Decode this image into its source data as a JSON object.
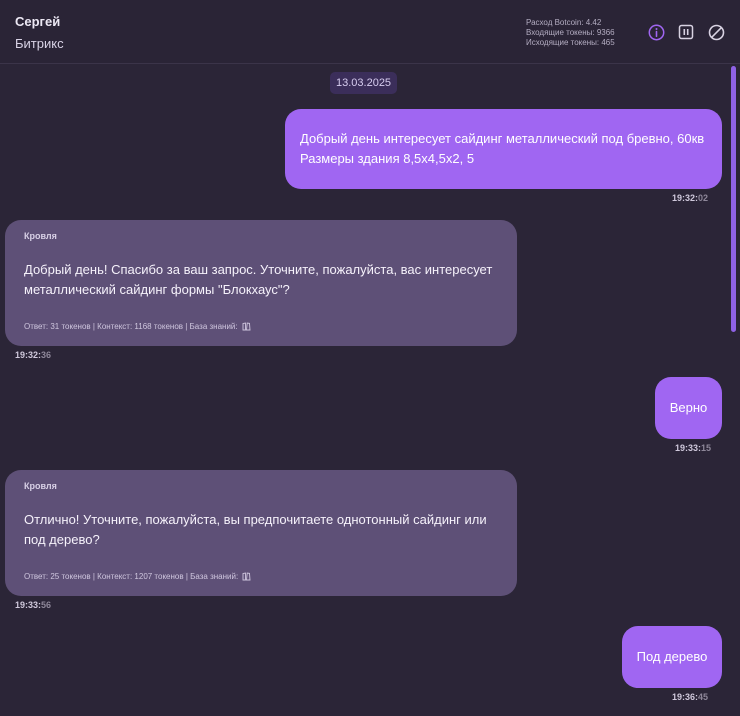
{
  "header": {
    "contact_name": "Сергей",
    "contact_source": "Битрикс",
    "stats": {
      "cost": "Расход Botcoin: 4.42",
      "input_tokens": "Входящие токены: 9366",
      "output_tokens": "Исходящие токены: 465"
    },
    "icons": [
      "info-icon",
      "pause-icon",
      "block-icon"
    ]
  },
  "chat": {
    "date": "13.03.2025",
    "messages": [
      {
        "direction": "out",
        "line1": "Добрый день интересует сайдинг металлический под бревно, 60кв",
        "line2": "Размеры здания 8,5х4,5х2, 5",
        "time_hm": "19:32:",
        "time_s": "02"
      },
      {
        "direction": "in",
        "sender": "Кровля",
        "line1": "Добрый день! Спасибо за ваш запрос. Уточните, пожалуйста, вас интересует",
        "line2": "металлический сайдинг формы \"Блокхаус\"?",
        "meta": "Ответ: 31 токенов | Контекст: 1168 токенов | База знаний:",
        "time_hm": "19:32:",
        "time_s": "36"
      },
      {
        "direction": "out",
        "line1": "Верно",
        "time_hm": "19:33:",
        "time_s": "15"
      },
      {
        "direction": "in",
        "sender": "Кровля",
        "line1": "Отлично! Уточните, пожалуйста, вы предпочитаете однотонный сайдинг или",
        "line2": "под дерево?",
        "meta": "Ответ: 25 токенов | Контекст: 1207 токенов | База знаний:",
        "time_hm": "19:33:",
        "time_s": "56"
      },
      {
        "direction": "out",
        "line1": "Под дерево",
        "time_hm": "19:36:",
        "time_s": "45"
      }
    ]
  },
  "colors": {
    "accent": "#a066f2",
    "background": "#2b2537",
    "incoming_bubble": "#5e5077"
  }
}
